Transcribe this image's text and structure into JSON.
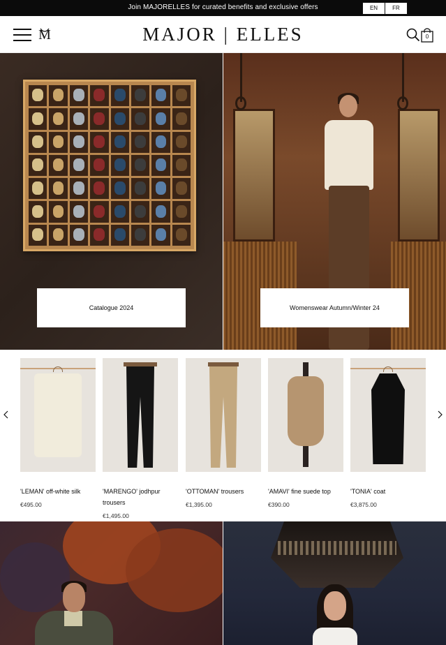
{
  "announcement": {
    "text": "Join MAJORELLES for curated benefits and exclusive offers",
    "languages": [
      "EN",
      "FR"
    ]
  },
  "header": {
    "brand": "MAJOR | ELLES",
    "monogram": "M",
    "cart_count": "0",
    "icons": [
      "hamburger-menu-icon",
      "monogram-logo-icon",
      "search-icon",
      "shopping-bag-icon"
    ]
  },
  "hero": {
    "left_cta": "Catalogue 2024",
    "right_cta": "Womenswear Autumn/Winter 24"
  },
  "products": [
    {
      "name": "'LEMAN' off-white silk",
      "price": "€495.00"
    },
    {
      "name": "'MARENGO' jodhpur trousers",
      "price": "€1,495.00"
    },
    {
      "name": "'OTTOMAN' trousers",
      "price": "€1,395.00"
    },
    {
      "name": "'AMAVI' fine suede top",
      "price": "€390.00"
    },
    {
      "name": "'TONIA' coat",
      "price": "€3,875.00"
    }
  ],
  "colors": {
    "announcement_bg": "#0b0b0b",
    "text": "#111111",
    "product_bg": "#e7e3dd"
  }
}
